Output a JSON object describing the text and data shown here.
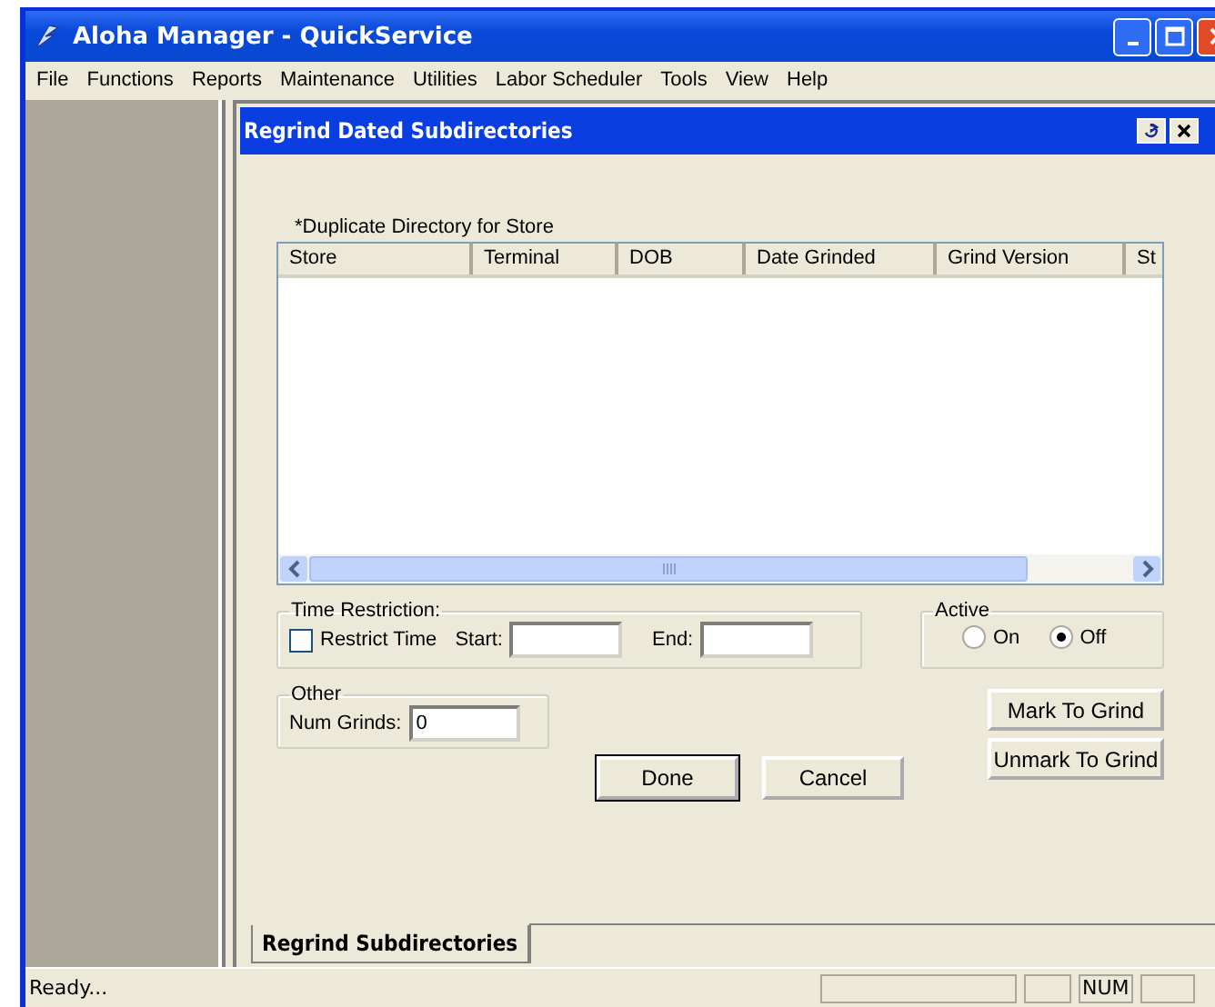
{
  "window": {
    "title": "Aloha Manager - QuickService"
  },
  "menu": [
    "File",
    "Functions",
    "Reports",
    "Maintenance",
    "Utilities",
    "Labor Scheduler",
    "Tools",
    "View",
    "Help"
  ],
  "dialog": {
    "title": "Regrind Dated Subdirectories",
    "list_label": "*Duplicate Directory for Store",
    "columns": [
      "Store",
      "Terminal",
      "DOB",
      "Date Grinded",
      "Grind Version",
      "St"
    ],
    "time_restriction": {
      "legend": "Time Restriction:",
      "checkbox_label": "Restrict Time",
      "checked": false,
      "start_label": "Start:",
      "end_label": "End:"
    },
    "active": {
      "legend": "Active",
      "options": [
        {
          "label": "On",
          "selected": false
        },
        {
          "label": "Off",
          "selected": true
        }
      ]
    },
    "other": {
      "legend": "Other",
      "num_grinds_label": "Num Grinds:",
      "num_grinds_value": "0"
    },
    "buttons": [
      {
        "label": "Done",
        "default": true
      },
      {
        "label": "Cancel",
        "default": false
      }
    ],
    "side_buttons": [
      "Mark To Grind",
      "Unmark To Grind"
    ]
  },
  "tabs": [
    {
      "label": "Regrind Subdirectories",
      "selected": true
    }
  ],
  "status_bar": {
    "text": "Ready...",
    "indicators": [
      {
        "kind": "empty"
      },
      {
        "kind": "empty"
      },
      {
        "kind": "text",
        "text": "NUM"
      },
      {
        "kind": "empty"
      }
    ]
  }
}
